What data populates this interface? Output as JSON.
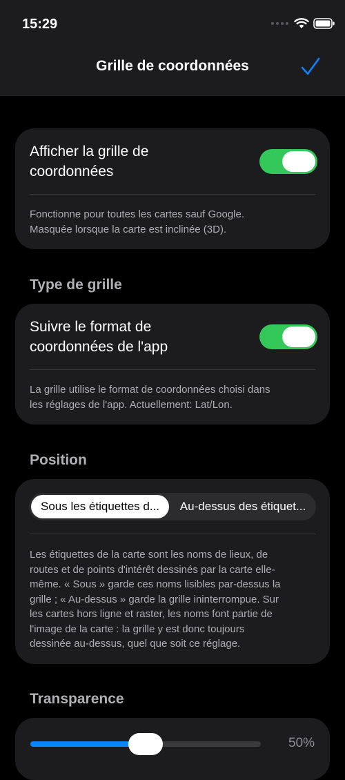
{
  "status_bar": {
    "time": "15:29"
  },
  "nav": {
    "title": "Grille de coordonnées",
    "done_icon": "checkmark-icon"
  },
  "colors": {
    "accent": "#0a84ff",
    "toggle_on": "#34c759",
    "card": "#1c1c1e"
  },
  "grid_section": {
    "show_grid_label_line1": "Afficher la grille de",
    "show_grid_label_line2": "coordonnées",
    "show_grid_on": true,
    "footnote_line1": "Fonctionne pour toutes les cartes sauf Google.",
    "footnote_line2": "Masquée lorsque la carte est inclinée (3D)."
  },
  "grid_type_section": {
    "header": "Type de grille",
    "follow_format_label_line1": "Suivre le format de",
    "follow_format_label_line2": "coordonnées de l'app",
    "follow_format_on": true,
    "footnote_line1": "La grille utilise le format de coordonnées choisi dans",
    "footnote_line2": "les réglages de l'app. Actuellement: Lat/Lon."
  },
  "position_section": {
    "header": "Position",
    "options": [
      "Sous les étiquettes d...",
      "Au-dessus des étiquet..."
    ],
    "selected_index": 0,
    "footnote_lines": [
      "Les étiquettes de la carte sont les noms de lieux, de",
      "routes et de points d'intérêt dessinés par la carte elle-",
      "même. « Sous » garde ces noms lisibles par-dessus la",
      "grille ; « Au-dessus » garde la grille ininterrompue. Sur",
      "les cartes hors ligne et raster, les noms font partie de",
      "l'image de la carte : la grille y est donc toujours",
      "dessinée au-dessus, quel que soit ce réglage."
    ]
  },
  "transparency_section": {
    "header": "Transparence",
    "value_text": "50%",
    "value_fraction": 0.5
  }
}
